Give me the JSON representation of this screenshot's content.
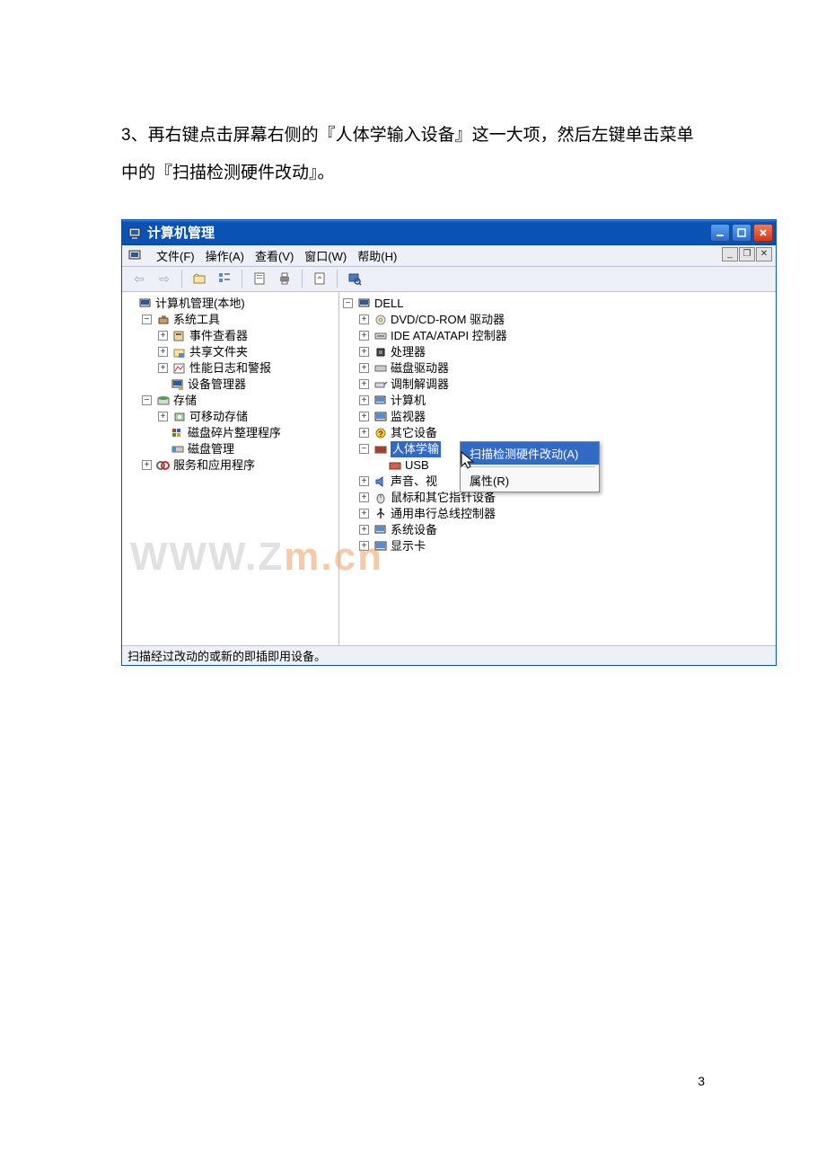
{
  "instruction_text": "3、再右键点击屏幕右侧的『人体学输入设备』这一大项，然后左键单击菜单中的『扫描检测硬件改动』。",
  "window": {
    "title": "计算机管理",
    "menubar": {
      "file": "文件(F)",
      "action": "操作(A)",
      "view": "查看(V)",
      "window": "窗口(W)",
      "help": "帮助(H)"
    },
    "left_tree": {
      "root": "计算机管理(本地)",
      "system_tools": "系统工具",
      "event_viewer": "事件查看器",
      "shared_folders": "共享文件夹",
      "perf_logs": "性能日志和警报",
      "device_manager": "设备管理器",
      "storage": "存储",
      "removable": "可移动存储",
      "defrag": "磁盘碎片整理程序",
      "disk_mgmt": "磁盘管理",
      "services_apps": "服务和应用程序"
    },
    "right_tree": {
      "root": "DELL",
      "dvd": "DVD/CD-ROM 驱动器",
      "ide": "IDE ATA/ATAPI 控制器",
      "cpu": "处理器",
      "disk_drive": "磁盘驱动器",
      "modem": "调制解调器",
      "computer": "计算机",
      "monitor": "监视器",
      "other": "其它设备",
      "hid": "人体学输",
      "usb": "USB",
      "sound": "声音、视",
      "mouse": "鼠标和其它指针设备",
      "usb_ctrl": "通用串行总线控制器",
      "sysdev": "系统设备",
      "display": "显示卡"
    },
    "context_menu": {
      "scan": "扫描检测硬件改动(A)",
      "properties": "属性(R)"
    },
    "statusbar": "扫描经过改动的或新的即插即用设备。"
  },
  "watermark": {
    "part1": "WWW.Z",
    "part2": "m.cn"
  },
  "page_number": "3"
}
